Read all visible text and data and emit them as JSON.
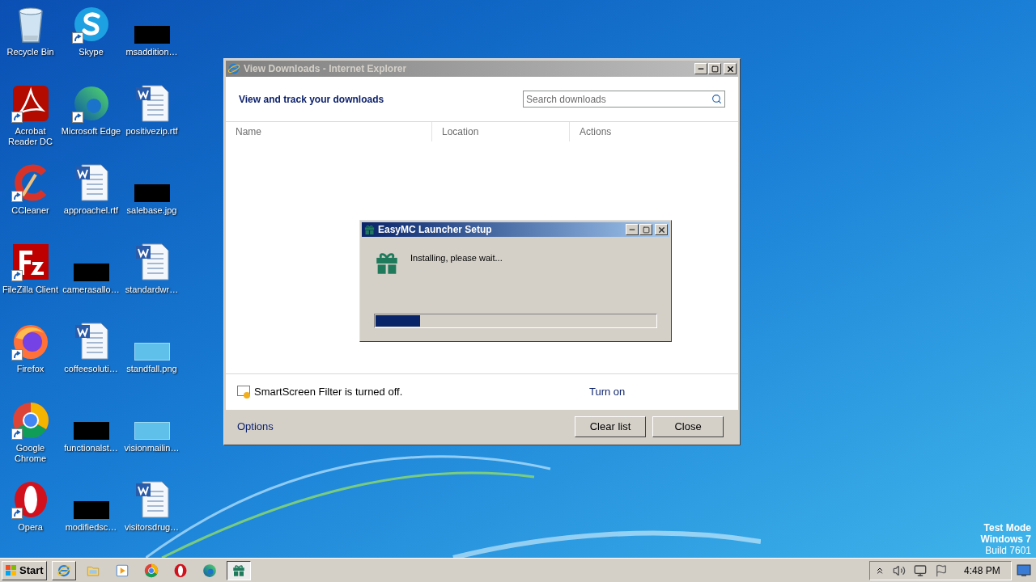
{
  "desktop_icons": [
    {
      "label": "Recycle Bin",
      "kind": "recycle"
    },
    {
      "label": "Acrobat Reader DC",
      "kind": "acrobat",
      "shortcut": true
    },
    {
      "label": "CCleaner",
      "kind": "ccleaner",
      "shortcut": true
    },
    {
      "label": "FileZilla Client",
      "kind": "filezilla",
      "shortcut": true
    },
    {
      "label": "Firefox",
      "kind": "firefox",
      "shortcut": true
    },
    {
      "label": "Google Chrome",
      "kind": "chrome",
      "shortcut": true
    },
    {
      "label": "Opera",
      "kind": "opera",
      "shortcut": true
    },
    {
      "label": "Skype",
      "kind": "skype",
      "shortcut": true
    },
    {
      "label": "Microsoft Edge",
      "kind": "edge",
      "shortcut": true
    },
    {
      "label": "approachel.rtf",
      "kind": "word"
    },
    {
      "label": "camerasallo…",
      "kind": "redacted"
    },
    {
      "label": "coffeesoluti…",
      "kind": "word"
    },
    {
      "label": "functionalst…",
      "kind": "redacted"
    },
    {
      "label": "modifiedsc…",
      "kind": "redacted"
    },
    {
      "label": "msaddition…",
      "kind": "redacted"
    },
    {
      "label": "positivezip.rtf",
      "kind": "word"
    },
    {
      "label": "salebase.jpg",
      "kind": "redacted"
    },
    {
      "label": "standardwr…",
      "kind": "word"
    },
    {
      "label": "standfall.png",
      "kind": "blank"
    },
    {
      "label": "visionmailin…",
      "kind": "blank"
    },
    {
      "label": "visitorsdrug…",
      "kind": "word"
    }
  ],
  "downloads_window": {
    "title": "View Downloads - Internet Explorer",
    "active": false,
    "heading": "View and track your downloads",
    "search": {
      "placeholder": "Search downloads"
    },
    "columns": [
      "Name",
      "Location",
      "Actions"
    ],
    "smartscreen": {
      "message": "SmartScreen Filter is turned off.",
      "link": "Turn on"
    },
    "options_link": "Options",
    "buttons": [
      "Clear list",
      "Close"
    ]
  },
  "setup_dialog": {
    "title": "EasyMC Launcher Setup",
    "active": true,
    "status": "Installing, please wait...",
    "progress": {
      "level": 0.16
    }
  },
  "watermark_text": [
    "Test Mode",
    "Windows 7",
    "Build 7601"
  ],
  "taskbar": {
    "start_label": "Start",
    "items": [
      {
        "kind": "ie",
        "open": true,
        "selected": false
      },
      {
        "kind": "folder",
        "open": false,
        "selected": false
      },
      {
        "kind": "media",
        "open": false,
        "selected": false
      },
      {
        "kind": "chrome",
        "open": false,
        "selected": false
      },
      {
        "kind": "opera",
        "open": false,
        "selected": false
      },
      {
        "kind": "edge",
        "open": false,
        "selected": false
      },
      {
        "kind": "gift",
        "open": true,
        "selected": true
      }
    ],
    "clock": "4:48 PM"
  }
}
